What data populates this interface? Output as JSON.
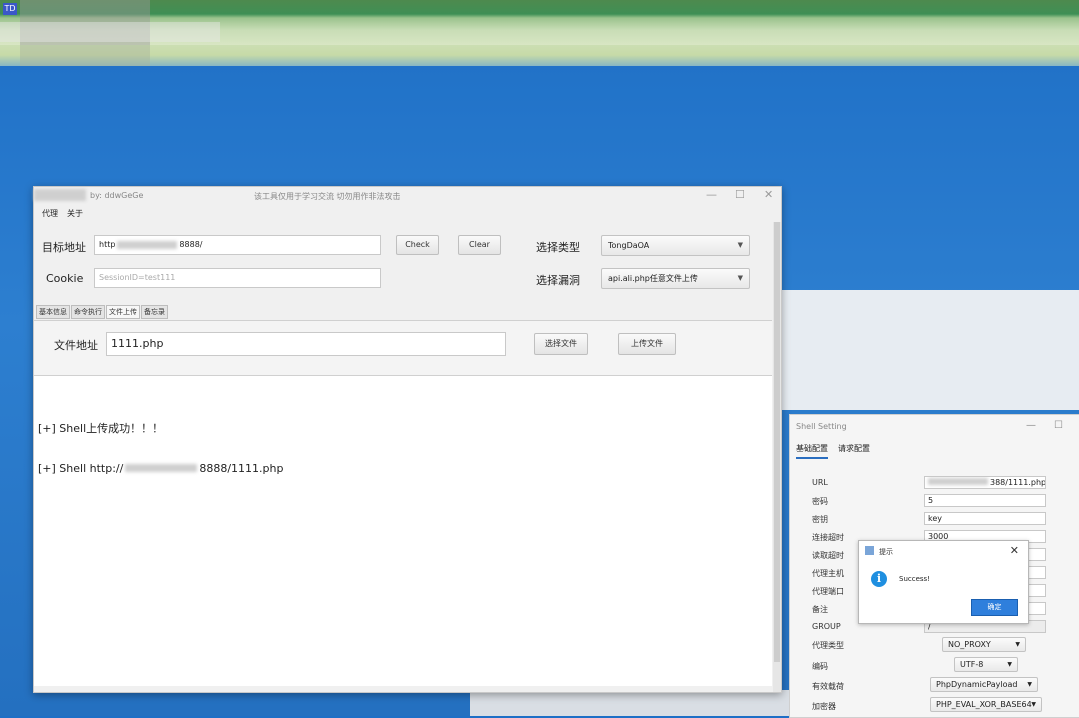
{
  "taskbar": {
    "app_icon": "TD"
  },
  "main": {
    "title_author": "by: ddwGeGe",
    "title_notice": "该工具仅用于学习交流 切勿用作非法攻击",
    "menu": [
      "代理",
      "关于"
    ],
    "target_label": "目标地址",
    "target_prefix": "http",
    "target_suffix": "8888/",
    "cookie_label": "Cookie",
    "cookie_placeholder": "SessionID=test111",
    "check_label": "Check",
    "clear_label": "Clear",
    "type_label": "选择类型",
    "type_value": "TongDaOA",
    "vuln_label": "选择漏洞",
    "vuln_value": "api.ali.php任意文件上传",
    "tabs": [
      "基本信息",
      "命令执行",
      "文件上传",
      "备忘录"
    ],
    "active_tab": 2,
    "file_label": "文件地址",
    "file_value": "1111.php",
    "choose_file_label": "选择文件",
    "upload_label": "上传文件",
    "output": {
      "line1": "[+] Shell上传成功！！！",
      "line2_prefix": "[+] Shell  http://",
      "line2_suffix": "8888/1111.php"
    }
  },
  "shell_setting": {
    "title": "Shell Setting",
    "tabs": [
      "基础配置",
      "请求配置"
    ],
    "url_label": "URL",
    "url_value": "388/1111.php",
    "password_label": "密码",
    "password_value": "5",
    "key_label": "密钥",
    "key_value": "key",
    "conn_timeout_label": "连接超时",
    "conn_timeout_value": "3000",
    "read_timeout_label": "读取超时",
    "proxy_host_label": "代理主机",
    "proxy_port_label": "代理端口",
    "note_label": "备注",
    "group_label": "GROUP",
    "group_value": "/",
    "proxy_type_label": "代理类型",
    "proxy_type_value": "NO_PROXY",
    "encoding_label": "编码",
    "encoding_value": "UTF-8",
    "payload_label": "有效载荷",
    "payload_value": "PhpDynamicPayload",
    "crypto_label": "加密器",
    "crypto_value": "PHP_EVAL_XOR_BASE64"
  },
  "dialog": {
    "title": "提示",
    "message": "Success!",
    "ok_label": "确定"
  }
}
